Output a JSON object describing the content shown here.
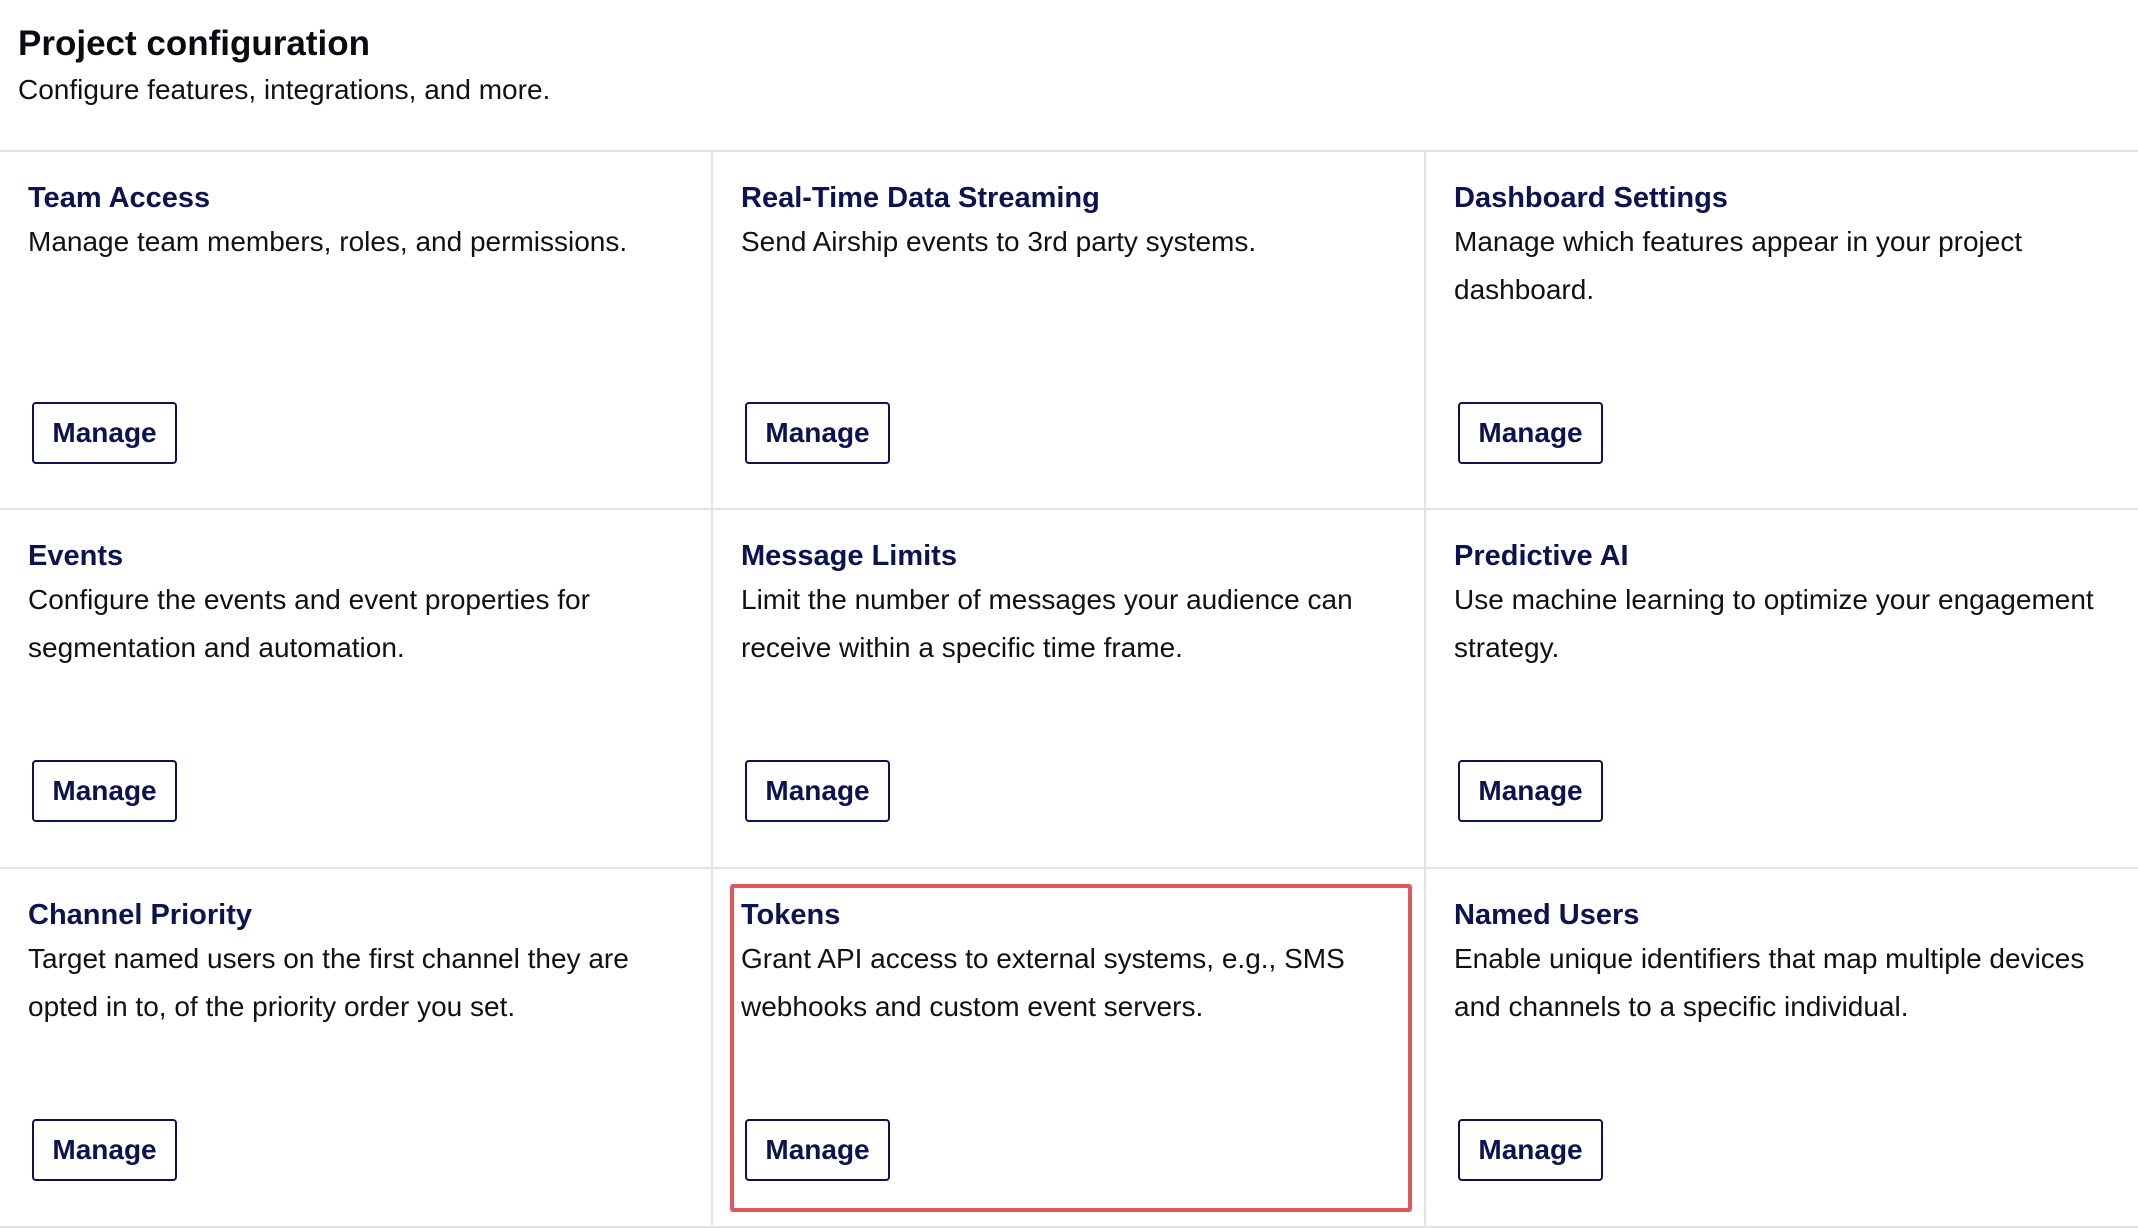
{
  "header": {
    "title": "Project configuration",
    "subtitle": "Configure features, integrations, and more."
  },
  "cards": [
    {
      "title": "Team Access",
      "description": "Manage team members, roles, and permissions.",
      "button": "Manage"
    },
    {
      "title": "Real-Time Data Streaming",
      "description": "Send Airship events to 3rd party systems.",
      "button": "Manage"
    },
    {
      "title": "Dashboard Settings",
      "description": "Manage which features appear in your project dashboard.",
      "button": "Manage"
    },
    {
      "title": "Events",
      "description": "Configure the events and event properties for segmentation and automation.",
      "button": "Manage"
    },
    {
      "title": "Message Limits",
      "description": "Limit the number of messages your audience can receive within a specific time frame.",
      "button": "Manage"
    },
    {
      "title": "Predictive AI",
      "description": "Use machine learning to optimize your engagement strategy.",
      "button": "Manage"
    },
    {
      "title": "Channel Priority",
      "description": "Target named users on the first channel they are opted in to, of the priority order you set.",
      "button": "Manage"
    },
    {
      "title": "Tokens",
      "description": "Grant API access to external systems, e.g., SMS webhooks and custom event servers.",
      "button": "Manage"
    },
    {
      "title": "Named Users",
      "description": "Enable unique identifiers that map multiple devices and channels to a specific individual.",
      "button": "Manage"
    }
  ],
  "highlight": {
    "card": "Tokens",
    "color": "#e0585c"
  },
  "colors": {
    "title": "#0b1450",
    "border": "#e3e3e6"
  }
}
